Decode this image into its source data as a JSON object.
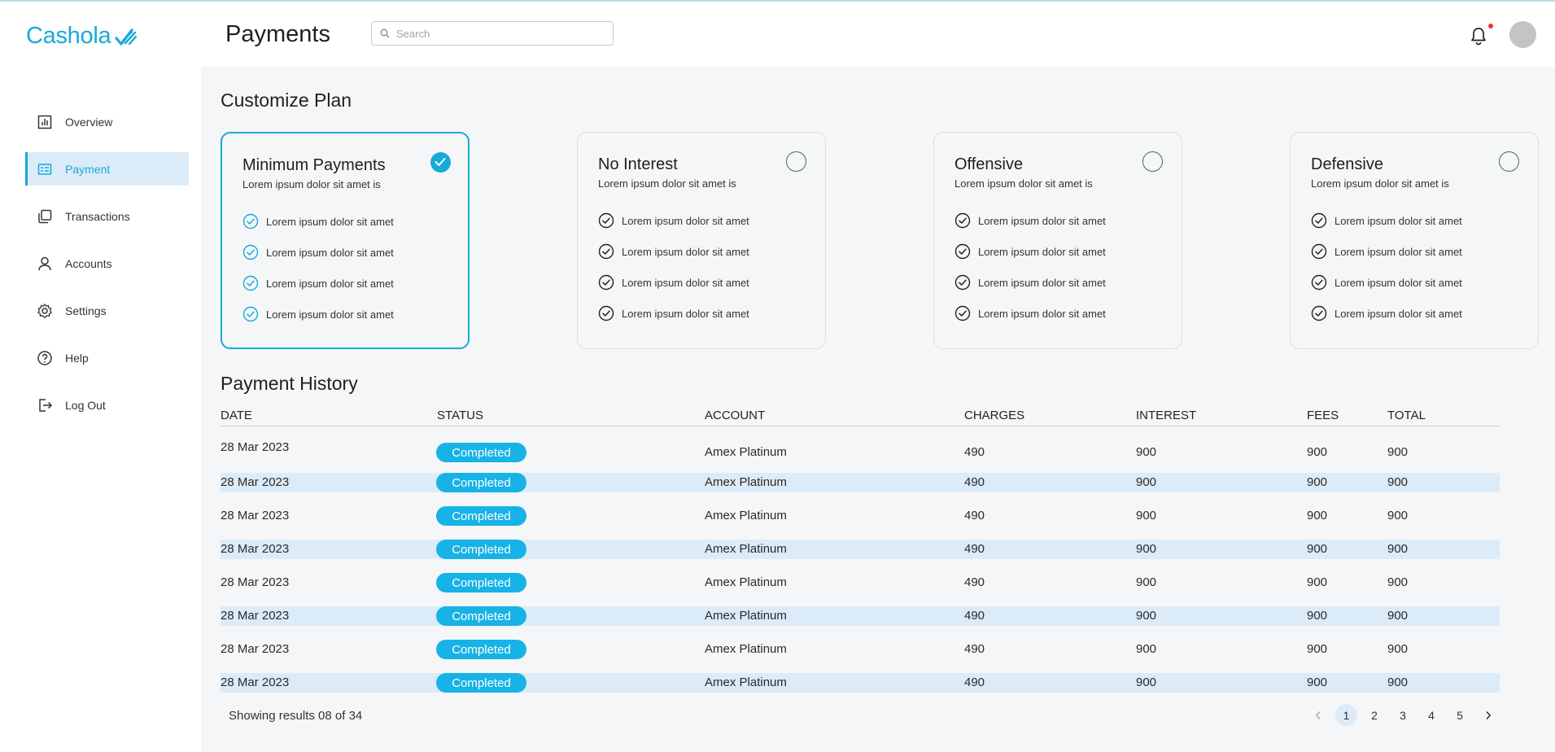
{
  "app": {
    "brand": "Cashola"
  },
  "sidebar": {
    "items": [
      {
        "label": "Overview",
        "icon": "bar-chart-icon"
      },
      {
        "label": "Payment",
        "icon": "payment-card-icon",
        "active": true
      },
      {
        "label": "Transactions",
        "icon": "transactions-icon"
      },
      {
        "label": "Accounts",
        "icon": "user-icon"
      },
      {
        "label": "Settings",
        "icon": "gear-icon"
      },
      {
        "label": "Help",
        "icon": "help-icon"
      },
      {
        "label": "Log Out",
        "icon": "logout-icon"
      }
    ]
  },
  "header": {
    "title": "Payments",
    "search_placeholder": "Search",
    "has_notification": true
  },
  "plans": {
    "title": "Customize Plan",
    "items": [
      {
        "name": "Minimum Payments",
        "desc": "Lorem ipsum dolor sit amet is",
        "selected": true,
        "features": [
          "Lorem ipsum dolor sit amet",
          "Lorem ipsum dolor sit amet",
          "Lorem ipsum dolor sit amet",
          "Lorem ipsum dolor sit amet"
        ]
      },
      {
        "name": "No Interest",
        "desc": "Lorem ipsum dolor sit amet is",
        "selected": false,
        "features": [
          "Lorem ipsum dolor sit amet",
          "Lorem ipsum dolor sit amet",
          "Lorem ipsum dolor sit amet",
          "Lorem ipsum dolor sit amet"
        ]
      },
      {
        "name": "Offensive",
        "desc": "Lorem ipsum dolor sit amet is",
        "selected": false,
        "features": [
          "Lorem ipsum dolor sit amet",
          "Lorem ipsum dolor sit amet",
          "Lorem ipsum dolor sit amet",
          "Lorem ipsum dolor sit amet"
        ]
      },
      {
        "name": "Defensive",
        "desc": "Lorem ipsum dolor sit amet is",
        "selected": false,
        "features": [
          "Lorem ipsum dolor sit amet",
          "Lorem ipsum dolor sit amet",
          "Lorem ipsum dolor sit amet",
          "Lorem ipsum dolor sit amet"
        ]
      }
    ]
  },
  "history": {
    "title": "Payment History",
    "columns": [
      "DATE",
      "STATUS",
      "ACCOUNT",
      "CHARGES",
      "INTEREST",
      "FEES",
      "TOTAL"
    ],
    "rows": [
      {
        "date": "28 Mar 2023",
        "status": "Completed",
        "account": "Amex Platinum",
        "charges": "490",
        "interest": "900",
        "fees": "900",
        "total": "900"
      },
      {
        "date": "28 Mar 2023",
        "status": "Completed",
        "account": "Amex Platinum",
        "charges": "490",
        "interest": "900",
        "fees": "900",
        "total": "900"
      },
      {
        "date": "28 Mar 2023",
        "status": "Completed",
        "account": "Amex Platinum",
        "charges": "490",
        "interest": "900",
        "fees": "900",
        "total": "900"
      },
      {
        "date": "28 Mar 2023",
        "status": "Completed",
        "account": "Amex Platinum",
        "charges": "490",
        "interest": "900",
        "fees": "900",
        "total": "900"
      },
      {
        "date": "28 Mar 2023",
        "status": "Completed",
        "account": "Amex Platinum",
        "charges": "490",
        "interest": "900",
        "fees": "900",
        "total": "900"
      },
      {
        "date": "28 Mar 2023",
        "status": "Completed",
        "account": "Amex Platinum",
        "charges": "490",
        "interest": "900",
        "fees": "900",
        "total": "900"
      },
      {
        "date": "28 Mar 2023",
        "status": "Completed",
        "account": "Amex Platinum",
        "charges": "490",
        "interest": "900",
        "fees": "900",
        "total": "900"
      },
      {
        "date": "28 Mar 2023",
        "status": "Completed",
        "account": "Amex Platinum",
        "charges": "490",
        "interest": "900",
        "fees": "900",
        "total": "900"
      }
    ],
    "results_text": "Showing results 08 of 34",
    "pages": [
      "1",
      "2",
      "3",
      "4",
      "5"
    ],
    "current_page": "1",
    "prev_icon": "chevron-left-icon",
    "next_icon": "chevron-right-icon"
  },
  "colors": {
    "accent": "#17a9d9",
    "badge": "#17b2e6",
    "stripe": "#dcebf8",
    "radio": "#2e7d32"
  }
}
